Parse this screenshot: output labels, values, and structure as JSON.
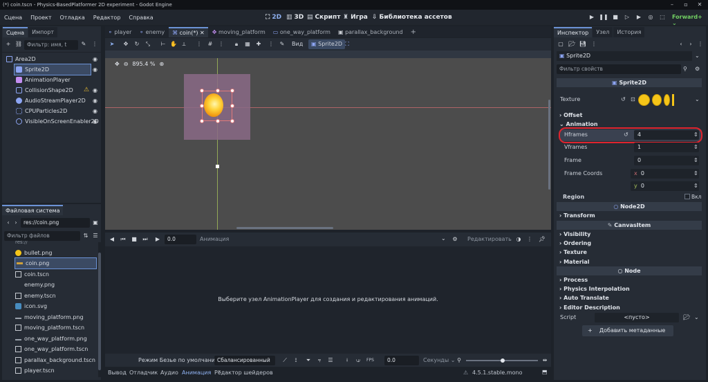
{
  "window": {
    "title": "(*) coin.tscn - Physics-BasedPlatformer 2D experiment - Godot Engine"
  },
  "menu": [
    "Сцена",
    "Проект",
    "Отладка",
    "Редактор",
    "Справка"
  ],
  "main_screens": [
    {
      "icon": "2d-icon",
      "label": "2D"
    },
    {
      "icon": "3d-icon",
      "label": "3D"
    },
    {
      "icon": "script-icon",
      "label": "Скрипт"
    },
    {
      "icon": "game-icon",
      "label": "Игра"
    },
    {
      "icon": "asset-library-icon",
      "label": "Библиотека ассетов"
    }
  ],
  "renderer": "Forward+",
  "scene_panel": {
    "tabs": [
      "Сцена",
      "Импорт"
    ],
    "filter_placeholder": "Фильтр: имя, t",
    "nodes": [
      {
        "name": "Area2D",
        "icon_color": "#8da5f3",
        "depth": 0
      },
      {
        "name": "Sprite2D",
        "icon_color": "#8da5f3",
        "depth": 1,
        "selected": true
      },
      {
        "name": "AnimationPlayer",
        "icon_color": "#c38ef1",
        "depth": 1
      },
      {
        "name": "CollisionShape2D",
        "icon_color": "#8da5f3",
        "depth": 1,
        "warning": true
      },
      {
        "name": "AudioStreamPlayer2D",
        "icon_color": "#8da5f3",
        "depth": 1
      },
      {
        "name": "CPUParticles2D",
        "icon_color": "#8da5f3",
        "depth": 1
      },
      {
        "name": "VisibleOnScreenEnabler2D",
        "icon_color": "#8da5f3",
        "depth": 1
      }
    ]
  },
  "filesystem": {
    "tab": "Файловая система",
    "path": "res://coin.png",
    "filter_placeholder": "Фильтр файлов",
    "partial_top": "res://",
    "files": [
      {
        "name": "bullet.png",
        "type": "image"
      },
      {
        "name": "coin.png",
        "type": "image",
        "selected": true
      },
      {
        "name": "coin.tscn",
        "type": "scene"
      },
      {
        "name": "enemy.png",
        "type": "image"
      },
      {
        "name": "enemy.tscn",
        "type": "scene"
      },
      {
        "name": "icon.svg",
        "type": "svg"
      },
      {
        "name": "moving_platform.png",
        "type": "image"
      },
      {
        "name": "moving_platform.tscn",
        "type": "scene"
      },
      {
        "name": "one_way_platform.png",
        "type": "image"
      },
      {
        "name": "one_way_platform.tscn",
        "type": "scene"
      },
      {
        "name": "parallax_background.tscn",
        "type": "scene"
      },
      {
        "name": "player.tscn",
        "type": "scene"
      }
    ]
  },
  "scene_tabs": [
    {
      "label": "player"
    },
    {
      "label": "enemy"
    },
    {
      "label": "coin(*)",
      "active": true
    },
    {
      "label": "moving_platform"
    },
    {
      "label": "one_way_platform"
    },
    {
      "label": "parallax_background"
    }
  ],
  "toolbar": {
    "view_label": "Вид",
    "sprite_label": "Sprite2D"
  },
  "viewport": {
    "zoom": "895.4 %"
  },
  "animation_panel": {
    "time": "0.0",
    "anim_label": "Анимация",
    "edit_label": "Редактировать",
    "message": "Выберите узел AnimationPlayer для создания и редактирования анимаций.",
    "bezier_label": "Режим Безье по умолчанию:",
    "bezier_value": "Сбалансированный",
    "snap_value": "0.0",
    "snap_unit": "Секунды",
    "fps_label": "FPS"
  },
  "bottom_tabs": [
    "Вывод",
    "Отладчик",
    "Аудио",
    "Анимация",
    "Редактор шейдеров"
  ],
  "version": "4.5.1.stable.mono",
  "inspector": {
    "tabs": [
      "Инспектор",
      "Узел",
      "История"
    ],
    "object": "Sprite2D",
    "filter_placeholder": "Фильтр свойств",
    "class_header": "Sprite2D",
    "texture_label": "Texture",
    "offset_label": "Offset",
    "animation_label": "Animation",
    "hframes_label": "Hframes",
    "hframes_value": "4",
    "vframes_label": "Vframes",
    "vframes_value": "1",
    "frame_label": "Frame",
    "frame_value": "0",
    "frame_coords_label": "Frame Coords",
    "coords_x_label": "x",
    "coords_x_value": "0",
    "coords_y_label": "y",
    "coords_y_value": "0",
    "region_label": "Region",
    "region_toggle": "Вкл",
    "node2d_header": "Node2D",
    "transform_label": "Transform",
    "canvasitem_header": "CanvasItem",
    "canvas_sections": [
      "Visibility",
      "Ordering",
      "Texture",
      "Material"
    ],
    "node_header": "Node",
    "node_sections": [
      "Process",
      "Physics Interpolation",
      "Auto Translate",
      "Editor Description"
    ],
    "script_label": "Script",
    "script_value": "<пусто>",
    "add_metadata": "Добавить метаданные"
  },
  "colors": {
    "accent": "#6c93d6",
    "highlight_red": "#e0242e",
    "coin": "#f5c518"
  }
}
